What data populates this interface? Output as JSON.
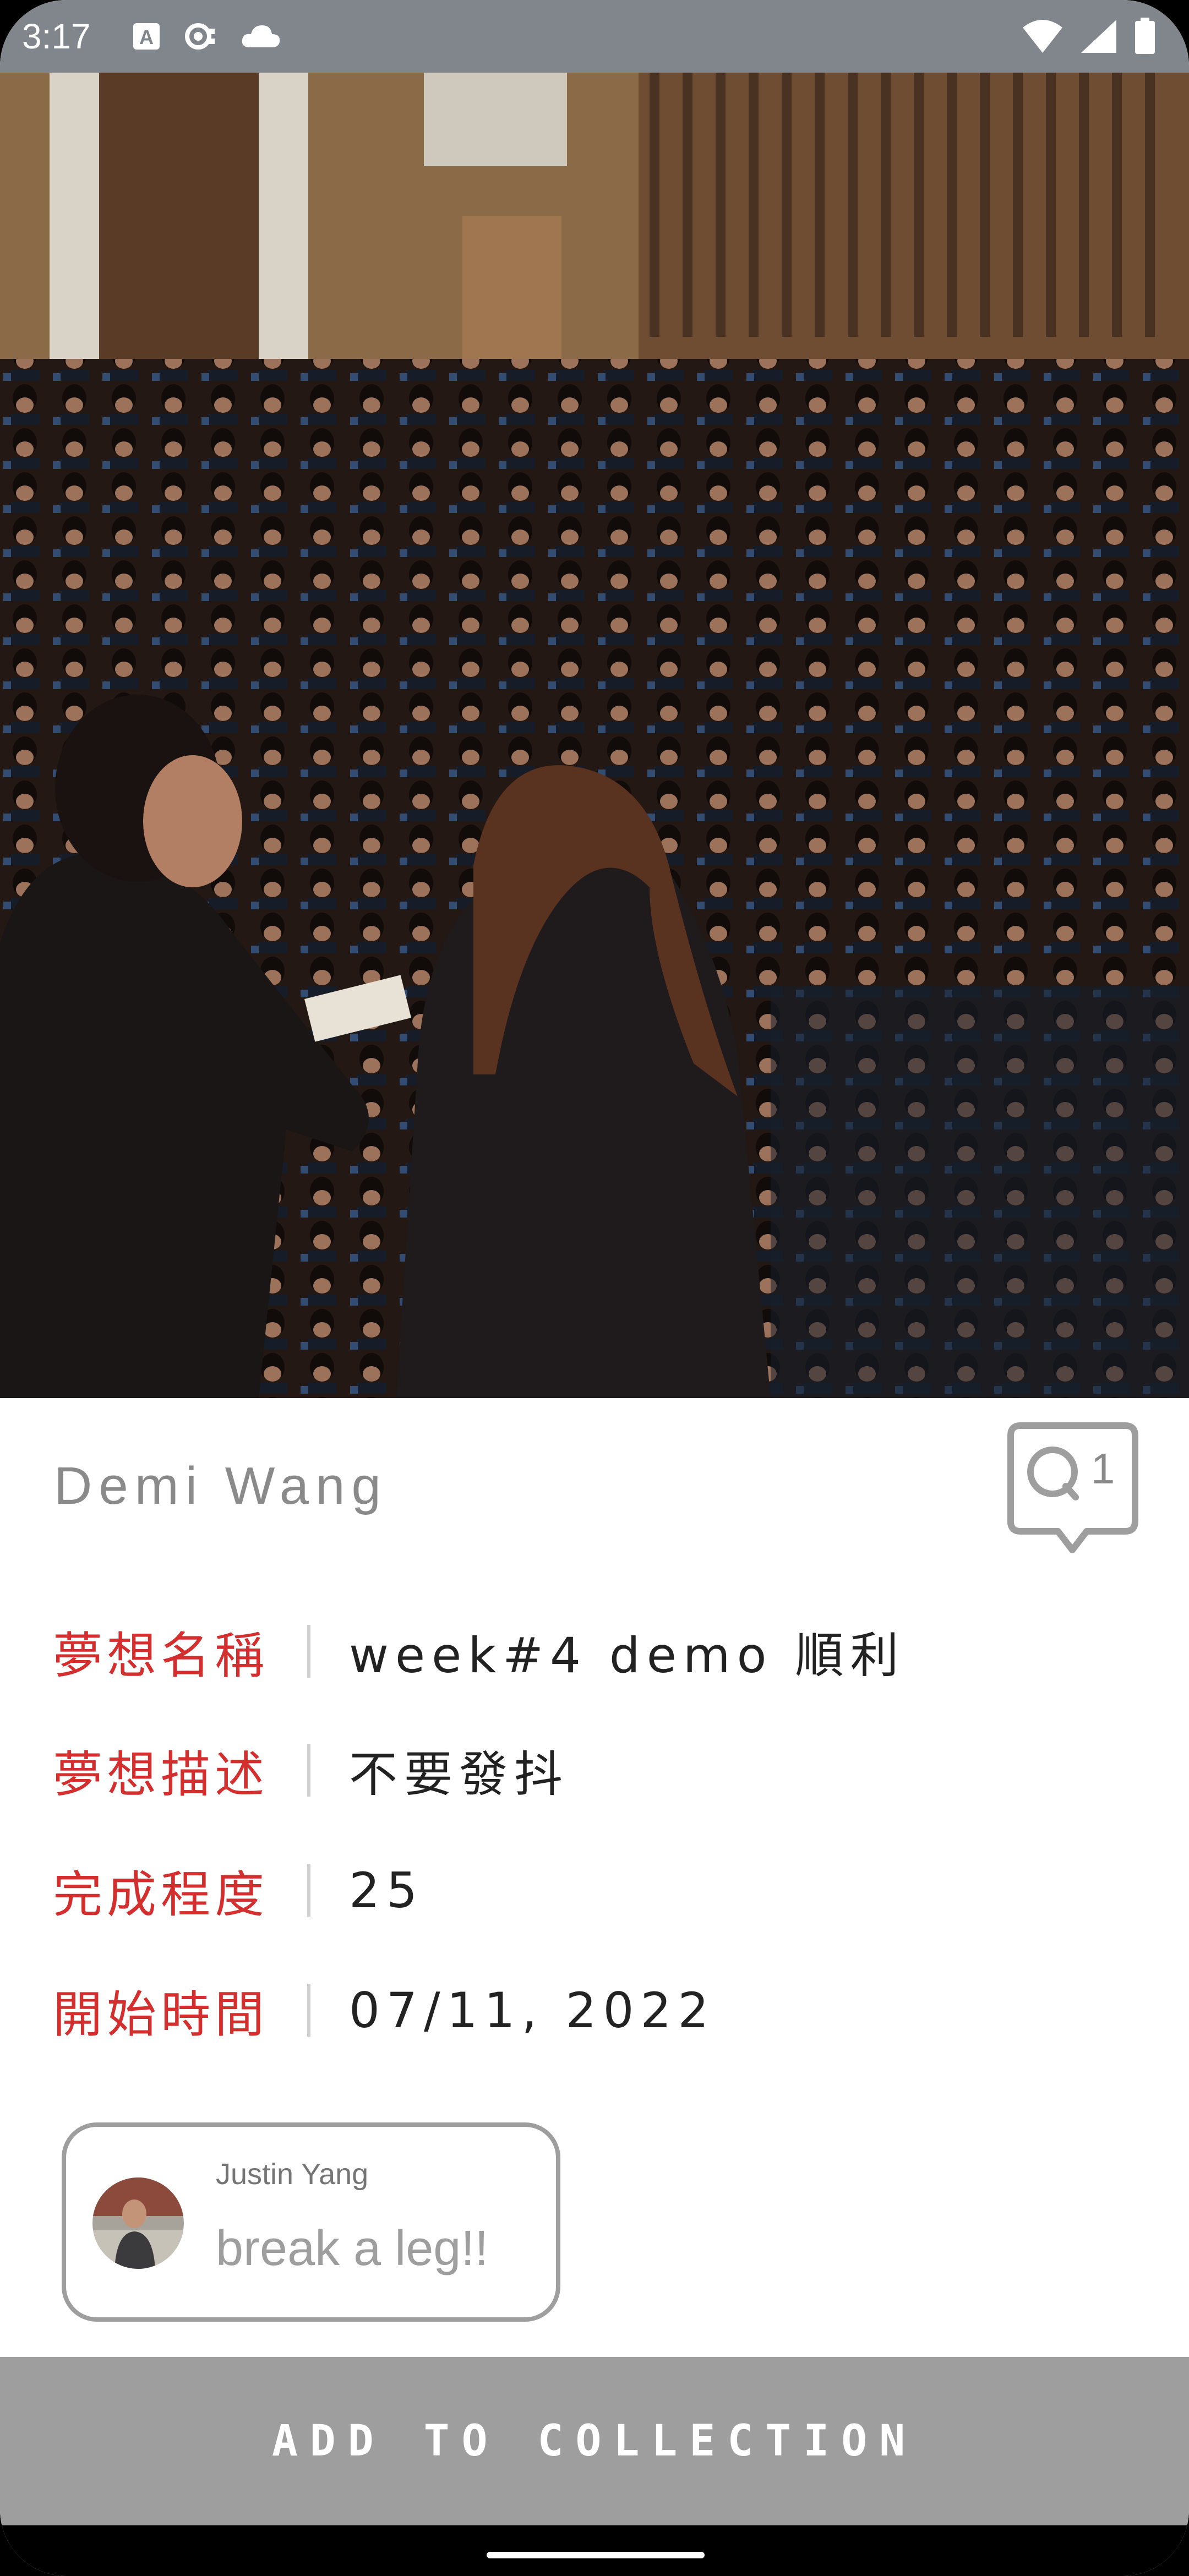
{
  "status_bar": {
    "time": "3:17",
    "icons_left": [
      "font-a-icon",
      "sync-icon",
      "cloud-icon"
    ],
    "icons_right": [
      "wifi-icon",
      "signal-icon",
      "battery-icon"
    ]
  },
  "hero": {
    "icon": "photo-speaker-audience"
  },
  "author": {
    "name": "Demi Wang"
  },
  "comment_button": {
    "icon": "comment-bubble-icon",
    "count": "1"
  },
  "fields": [
    {
      "label": "夢想名稱",
      "value": "week#4  demo 順利"
    },
    {
      "label": "夢想描述",
      "value": "不要發抖"
    },
    {
      "label": "完成程度",
      "value": "25"
    },
    {
      "label": "開始時間",
      "value": "07/11, 2022"
    }
  ],
  "comment": {
    "author": "Justin Yang",
    "text": "break a leg!!",
    "avatar_icon": "user-avatar-icon"
  },
  "add_button": {
    "label": "ADD TO COLLECTION"
  },
  "colors": {
    "label_red": "#d32f2f",
    "status_bar": "#80868b",
    "button_gray": "#9e9e9e"
  }
}
